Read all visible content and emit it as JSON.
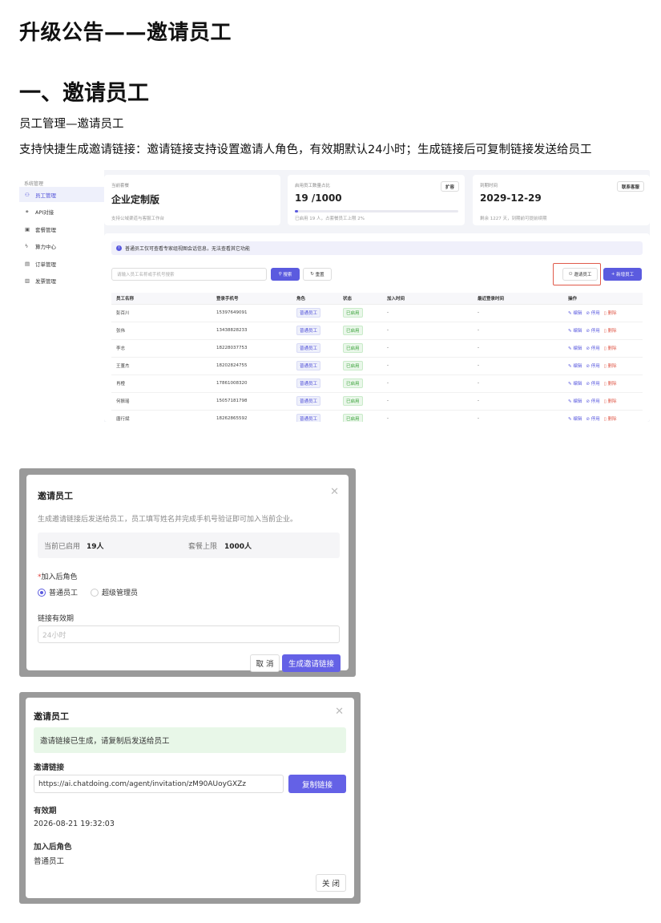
{
  "doc": {
    "title": "升级公告——邀请员工",
    "section_title": "一、邀请员工",
    "para1": "员工管理—邀请员工",
    "para2": "支持快捷生成邀请链接：邀请链接支持设置邀请人角色，有效期默认24小时；生成链接后可复制链接发送给员工"
  },
  "admin": {
    "sidebar": {
      "caption": "系统管理",
      "items": [
        {
          "label": "员工管理",
          "icon": "users-icon",
          "glyph": "⚇",
          "active": true
        },
        {
          "label": "API对接",
          "icon": "link-icon",
          "glyph": "⚭",
          "active": false
        },
        {
          "label": "套餐管理",
          "icon": "package-icon",
          "glyph": "▣",
          "active": false
        },
        {
          "label": "算力中心",
          "icon": "lightning-icon",
          "glyph": "ϟ",
          "active": false
        },
        {
          "label": "订单管理",
          "icon": "order-icon",
          "glyph": "▤",
          "active": false
        },
        {
          "label": "发票管理",
          "icon": "invoice-icon",
          "glyph": "▥",
          "active": false
        }
      ]
    },
    "cards": {
      "plan": {
        "caption": "当前套餐",
        "value": "企业定制版",
        "sub": "支持公域渠道与客服工作台"
      },
      "seats": {
        "caption": "启用员工数量占比",
        "button": "扩容",
        "value": "19 /1000",
        "progress": 0.02,
        "sub": "已启用 19 人，占套餐员工上限 2%"
      },
      "expiry": {
        "caption": "到期时间",
        "button": "联系客服",
        "value": "2029-12-29",
        "sub": "剩余 1227 天，到期前可提前续期"
      }
    },
    "notice": "普通员工仅可查看专家组视图会话信息，无法查看其它功能",
    "search_placeholder": "请输入员工名称或手机号搜索",
    "search_btn": "搜索",
    "reset_btn": "重置",
    "invite_btn": "邀请员工",
    "new_btn": "新增员工",
    "columns": [
      "员工名称",
      "登录手机号",
      "角色",
      "状态",
      "加入时间",
      "最近登录时间",
      "操作"
    ],
    "rows": [
      {
        "name": "彭百川",
        "phone": "15397649091",
        "role": "普通员工",
        "status": "已启用",
        "joined": "-",
        "last": "-"
      },
      {
        "name": "张伟",
        "phone": "13438828233",
        "role": "普通员工",
        "status": "已启用",
        "joined": "-",
        "last": "-"
      },
      {
        "name": "李志",
        "phone": "18228037753",
        "role": "普通员工",
        "status": "已启用",
        "joined": "-",
        "last": "-"
      },
      {
        "name": "王董杰",
        "phone": "18202824755",
        "role": "普通员工",
        "status": "已启用",
        "joined": "-",
        "last": "-"
      },
      {
        "name": "肖橙",
        "phone": "17861008320",
        "role": "普通员工",
        "status": "已启用",
        "joined": "-",
        "last": "-"
      },
      {
        "name": "何振瑶",
        "phone": "15057181798",
        "role": "普通员工",
        "status": "已启用",
        "joined": "-",
        "last": "-"
      },
      {
        "name": "唐行斌",
        "phone": "18262865592",
        "role": "普通员工",
        "status": "已启用",
        "joined": "-",
        "last": "-"
      }
    ],
    "ops": {
      "edit": "编辑",
      "disable": "停用",
      "delete": "删除"
    }
  },
  "invite_dialog": {
    "title": "邀请员工",
    "desc": "生成邀请链接后发送给员工，员工填写姓名并完成手机号验证即可加入当前企业。",
    "enabled_label": "当前已启用",
    "enabled_value": "19人",
    "limit_label": "套餐上限",
    "limit_value": "1000人",
    "role_label": "加入后角色",
    "role_required_mark": "*",
    "role_options": [
      "普通员工",
      "超级管理员"
    ],
    "role_selected": "普通员工",
    "validity_label": "链接有效期",
    "validity_placeholder": "24小时",
    "cancel_btn": "取 消",
    "generate_btn": "生成邀请链接"
  },
  "result_dialog": {
    "title": "邀请员工",
    "success_msg": "邀请链接已生成，请复制后发送给员工",
    "link_label": "邀请链接",
    "link_value": "https://ai.chatdoing.com/agent/invitation/zM90AUoyGXZz",
    "copy_btn": "复制链接",
    "expiry_label": "有效期",
    "expiry_value": "2026-08-21 19:32:03",
    "role_label": "加入后角色",
    "role_value": "普通员工",
    "close_btn": "关 闭"
  }
}
